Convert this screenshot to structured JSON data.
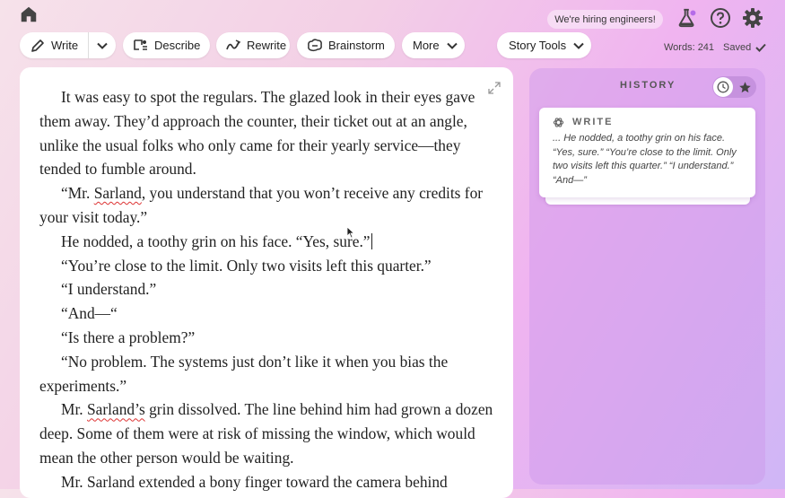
{
  "nav": {
    "home_icon": "home-icon"
  },
  "toolbar": {
    "write_label": "Write",
    "describe_label": "Describe",
    "rewrite_label": "Rewrite",
    "brainstorm_label": "Brainstorm",
    "more_label": "More",
    "story_tools_label": "Story Tools"
  },
  "header": {
    "hiring_text": "We're hiring engineers!",
    "word_count": "Words: 241",
    "save_status": "Saved"
  },
  "editor": {
    "paragraphs": [
      {
        "text": "It was easy to spot the regulars. The glazed look in their eyes gave them away. They’d approach the counter, their ticket out at an angle, unlike the usual folks who only came for their yearly service—they tended to fumble around."
      },
      {
        "pre": "“Mr. ",
        "mark": "Sarland",
        "post": ", you understand that you won’t receive any credits for your visit today.”"
      },
      {
        "text": "He nodded, a toothy grin on his face. “Yes, sure.”"
      },
      {
        "text": "“You’re close to the limit. Only two visits left this quarter.”"
      },
      {
        "text": "“I understand.”"
      },
      {
        "text": "“And—“"
      },
      {
        "text": "“Is there a problem?”"
      },
      {
        "text": "“No problem. The systems just don’t like it when you bias the experiments.”"
      },
      {
        "pre": "Mr. ",
        "mark": "Sarland’s",
        "post": " grin dissolved. The line behind him had grown a dozen deep. Some of them were at risk of missing the window, which would mean the other person would be waiting."
      },
      {
        "text": "Mr. Sarland extended a bony finger toward the camera behind"
      }
    ]
  },
  "history": {
    "title": "HISTORY",
    "card": {
      "type_label": "WRITE",
      "excerpt": "... He nodded, a toothy grin on his face. “Yes, sure.” “You’re close to the limit. Only two visits left this quarter.” “I understand.” “And—”"
    }
  }
}
